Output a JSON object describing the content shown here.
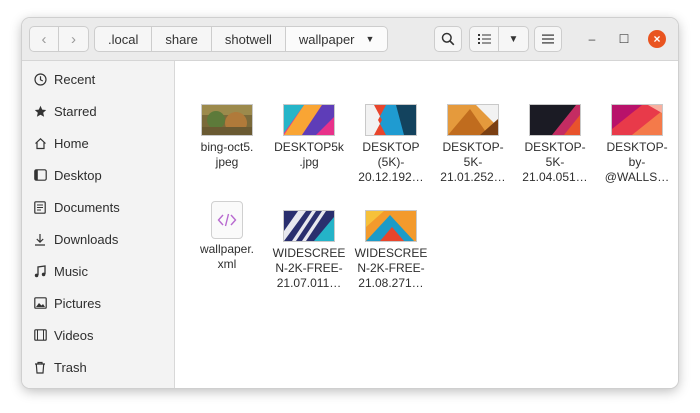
{
  "nav": {
    "back_icon": "‹",
    "forward_icon": "›"
  },
  "breadcrumbs": [
    ".local",
    "share",
    "shotwell",
    "wallpaper"
  ],
  "toolbar": {
    "search_icon": "search-icon",
    "list_view_icon": "list-view-icon",
    "view_options_icon": "chevron-down-icon",
    "menu_icon": "hamburger-menu-icon",
    "minimize": "–",
    "maximize": "☐",
    "close": "×"
  },
  "sidebar": {
    "items": [
      {
        "label": "Recent",
        "icon": "clock-icon"
      },
      {
        "label": "Starred",
        "icon": "star-icon"
      },
      {
        "label": "Home",
        "icon": "home-icon"
      },
      {
        "label": "Desktop",
        "icon": "desktop-icon"
      },
      {
        "label": "Documents",
        "icon": "document-icon"
      },
      {
        "label": "Downloads",
        "icon": "download-icon"
      },
      {
        "label": "Music",
        "icon": "music-icon"
      },
      {
        "label": "Pictures",
        "icon": "picture-icon"
      },
      {
        "label": "Videos",
        "icon": "video-icon"
      },
      {
        "label": "Trash",
        "icon": "trash-icon"
      }
    ]
  },
  "files": [
    {
      "name": "bing-oct5.\njpeg"
    },
    {
      "name": "DESKTOP5k\n.jpg"
    },
    {
      "name": "DESKTOP\n(5K)-\n20.12.192…"
    },
    {
      "name": "DESKTOP-\n5K-\n21.01.252…"
    },
    {
      "name": "DESKTOP-\n5K-\n21.04.051…"
    },
    {
      "name": "DESKTOP-\nby-\n@WALLS…"
    },
    {
      "name": "wallpaper.\nxml"
    },
    {
      "name": "WIDESCREE\nN-2K-FREE-\n21.07.011…"
    },
    {
      "name": "WIDESCREE\nN-2K-FREE-\n21.08.271…"
    }
  ],
  "colors": {
    "accent": "#e95420",
    "sidebar_bg": "#f3f3f3",
    "header_bg": "#ebebeb"
  }
}
